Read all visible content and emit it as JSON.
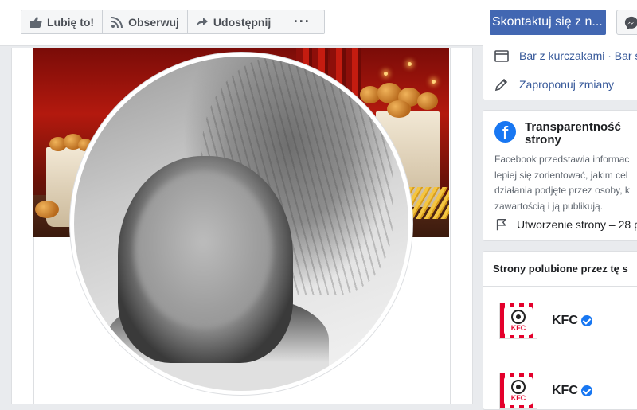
{
  "actions": {
    "like_label": "Lubię to!",
    "follow_label": "Obserwuj",
    "share_label": "Udostępnij",
    "more_label": "···"
  },
  "contact_button": "Skontaktuj się z n...",
  "about": {
    "category": "Bar z kurczakami · Bar s",
    "suggest_edit": "Zaproponuj zmiany"
  },
  "transparency": {
    "title": "Transparentność strony",
    "body_lines": [
      "Facebook przedstawia informac",
      "lepiej się zorientować, jakim cel",
      "działania podjęte przez osoby, k",
      "zawartością i ją publikują."
    ],
    "created": "Utworzenie strony – 28 p"
  },
  "liked_pages": {
    "title": "Strony polubione przez tę s",
    "items": [
      {
        "name": "KFC",
        "logo_text": "KFC"
      },
      {
        "name": "KFC",
        "logo_text": "KFC"
      }
    ]
  },
  "colors": {
    "primary": "#4267b2",
    "link": "#365899",
    "verified": "#1877f2",
    "kfc_red": "#e4002b"
  }
}
